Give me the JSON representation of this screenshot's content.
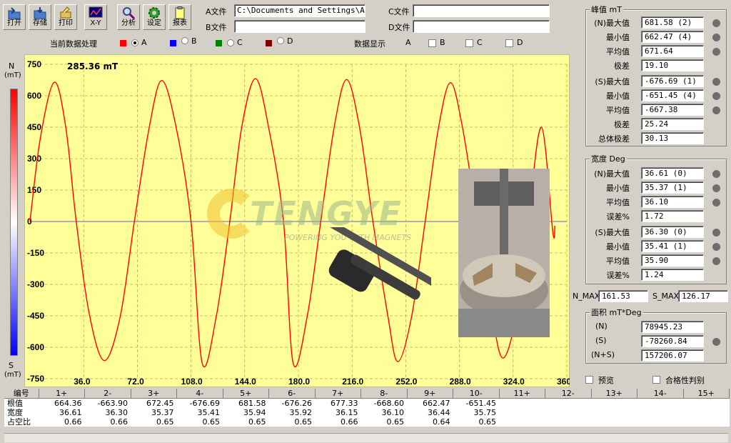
{
  "toolbar": [
    {
      "label": "打开",
      "icon": "open-icon"
    },
    {
      "label": "存储",
      "icon": "save-icon"
    },
    {
      "label": "打印",
      "icon": "print-icon"
    },
    {
      "label": "X-Y",
      "icon": "xy-chart-icon"
    },
    {
      "label": "分析",
      "icon": "analyze-icon"
    },
    {
      "label": "设定",
      "icon": "settings-gear-icon"
    },
    {
      "label": "报表",
      "icon": "report-clipboard-icon"
    }
  ],
  "files": {
    "a_label": "A文件",
    "a_value": "C:\\Documents and Settings\\Ad",
    "b_label": "B文件",
    "b_value": "",
    "c_label": "C文件",
    "c_value": "",
    "d_label": "D文件",
    "d_value": ""
  },
  "processing": {
    "label": "当前数据处理",
    "options": [
      {
        "label": "A",
        "color": "#ff0000",
        "selected": true
      },
      {
        "label": "B",
        "color": "#0000ff",
        "selected": false
      },
      {
        "label": "C",
        "color": "#008000",
        "selected": false
      },
      {
        "label": "D",
        "color": "#800000",
        "selected": false
      }
    ]
  },
  "display": {
    "label": "数据显示",
    "items": [
      "A",
      "B",
      "C",
      "D"
    ]
  },
  "chart_data": {
    "type": "line",
    "title": "",
    "readout": "285.36 mT",
    "ylabel_top": "N",
    "ylabel_top_unit": "(mT)",
    "ylabel_bottom": "S",
    "ylabel_bottom_unit": "(mT)",
    "ylim": [
      -750,
      750
    ],
    "xlim": [
      0,
      360
    ],
    "y_ticks": [
      "750",
      "600",
      "450",
      "300",
      "150",
      "0",
      "-150",
      "-300",
      "-450",
      "-600",
      "-750"
    ],
    "x_ticks": [
      "36.0",
      "72.0",
      "108.0",
      "144.0",
      "180.0",
      "216.0",
      "252.0",
      "288.0",
      "324.0",
      "360.0"
    ],
    "series": [
      {
        "color": "#ff0000",
        "x": [
          0,
          7,
          16.3,
          24,
          31,
          40,
          50,
          60.6,
          70,
          80,
          88.4,
          98,
          108,
          115.5,
          125,
          134,
          142,
          151.2,
          160,
          170,
          176.5,
          186,
          195,
          204,
          212.3,
          221,
          230,
          240,
          246.7,
          256,
          265,
          274,
          282,
          290,
          300,
          310,
          317.2,
          326,
          334,
          343,
          350.6,
          352
        ],
        "y": [
          0,
          400,
          664.36,
          450,
          0,
          -450,
          -663.9,
          -450,
          0,
          450,
          672.45,
          450,
          0,
          -676.69,
          -450,
          0,
          450,
          681.58,
          450,
          0,
          -676.26,
          -450,
          0,
          450,
          677.33,
          450,
          0,
          -450,
          -668.6,
          -450,
          0,
          450,
          662.47,
          450,
          0,
          -450,
          -651.45,
          -450,
          0,
          450,
          -50,
          -20
        ]
      }
    ],
    "grid": true,
    "background": "#ffff99"
  },
  "peak": {
    "title": "峰值  mT",
    "n_max_label": "(N)最大值",
    "n_max": "681.58 (2)",
    "n_min_label": "最小值",
    "n_min": "662.47 (4)",
    "n_avg_label": "平均值",
    "n_avg": "671.64",
    "n_range_label": "极差",
    "n_range": "19.10",
    "s_max_label": "(S)最大值",
    "s_max": "-676.69 (1)",
    "s_min_label": "最小值",
    "s_min": "-651.45 (4)",
    "s_avg_label": "平均值",
    "s_avg": "-667.38",
    "s_range_label": "极差",
    "s_range": "25.24",
    "total_range_label": "总体极差",
    "total_range": "30.13"
  },
  "width": {
    "title": "宽度 Deg",
    "n_max_label": "(N)最大值",
    "n_max": "36.61 (0)",
    "n_min_label": "最小值",
    "n_min": "35.37 (1)",
    "n_avg_label": "平均值",
    "n_avg": "36.10",
    "n_err_label": "误差%",
    "n_err": "1.72",
    "s_max_label": "(S)最大值",
    "s_max": "36.30 (0)",
    "s_min_label": "最小值",
    "s_min": "35.41 (1)",
    "s_avg_label": "平均值",
    "s_avg": "35.90",
    "s_err_label": "误差%",
    "s_err": "1.24"
  },
  "extremes": {
    "n_label": "N_MAX",
    "n_value": "161.53",
    "s_label": "S_MAX",
    "s_value": "126.17"
  },
  "area": {
    "title": "面积  mT*Deg",
    "n_label": "(N)",
    "n_value": "78945.23",
    "s_label": "(S)",
    "s_value": "-78260.84",
    "ns_label": "(N+S)",
    "ns_value": "157206.07"
  },
  "options": {
    "preview": "预览",
    "qualify": "合格性判别"
  },
  "table": {
    "headers": [
      "编号",
      "1+",
      "2-",
      "3+",
      "4-",
      "5+",
      "6-",
      "7+",
      "8-",
      "9+",
      "10-",
      "11+",
      "12-",
      "13+",
      "14-",
      "15+"
    ],
    "rows": [
      {
        "label": "根值",
        "values": [
          "664.36",
          "-663.90",
          "672.45",
          "-676.69",
          "681.58",
          "-676.26",
          "677.33",
          "-668.60",
          "662.47",
          "-651.45",
          "",
          "",
          "",
          "",
          ""
        ]
      },
      {
        "label": "宽度",
        "values": [
          "36.61",
          "36.30",
          "35.37",
          "35.41",
          "35.94",
          "35.92",
          "36.15",
          "36.10",
          "36.44",
          "35.75",
          "",
          "",
          "",
          "",
          ""
        ]
      },
      {
        "label": "占空比",
        "values": [
          "0.66",
          "0.66",
          "0.65",
          "0.65",
          "0.65",
          "0.65",
          "0.66",
          "0.65",
          "0.64",
          "0.65",
          "",
          "",
          "",
          "",
          ""
        ]
      }
    ]
  },
  "watermark": {
    "brand": "TENGYE",
    "slogan": "POWERING YOU WITH MAGNETS"
  }
}
